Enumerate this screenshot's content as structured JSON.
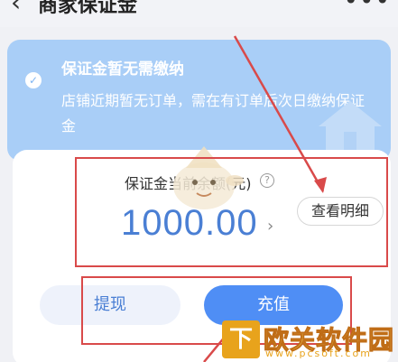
{
  "header": {
    "back_icon": "‹",
    "title": "商家保证金",
    "more_icon": "•••"
  },
  "notice": {
    "title": "保证金暂无需缴纳",
    "body": "店铺近期暂无订单，需在有订单后次日缴纳保证金"
  },
  "balance": {
    "label": "保证金当前余额(元)",
    "help_icon": "?",
    "amount": "1000.00",
    "chevron": "›",
    "details_label": "查看明细"
  },
  "actions": {
    "withdraw_label": "提现",
    "recharge_label": "充值"
  },
  "watermark": {
    "logo": "下",
    "text": "欧关软件园",
    "url": "www.pcsoft.com"
  },
  "colors": {
    "accent": "#4f8ef5",
    "notice_bg": "#a9cef7",
    "annotation": "#d94a4a"
  }
}
